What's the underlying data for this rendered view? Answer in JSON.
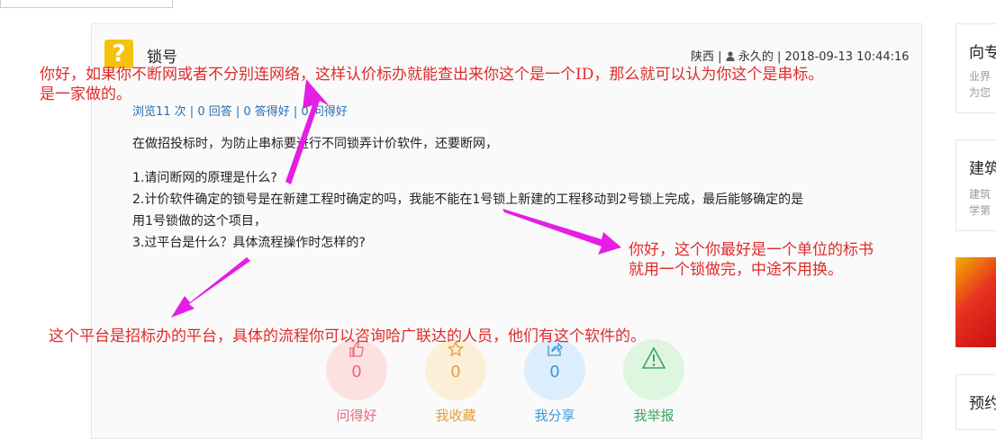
{
  "question": {
    "title": "锁号",
    "location": "陕西",
    "author": "永久的",
    "datetime": "2018-09-13 10:44:16",
    "stats": "浏览11 次 | 0 回答 | 0 答得好 | 0 问得好",
    "paragraphs": [
      "在做招投标时，为防止串标要进行不同锁弄计价软件，还要断网，",
      "1.请问断网的原理是什么?",
      "2.计价软件确定的锁号是在新建工程时确定的吗，我能不能在1号锁上新建的工程移动到2号锁上完成，最后能够确定的是",
      "用1号锁做的这个项目，",
      "3.过平台是什么？具体流程操作时怎样的?"
    ]
  },
  "actions": [
    {
      "count": "0",
      "label": "问得好",
      "icon": "thumbs-up-icon"
    },
    {
      "count": "0",
      "label": "我收藏",
      "icon": "star-icon"
    },
    {
      "count": "0",
      "label": "我分享",
      "icon": "share-icon"
    },
    {
      "count": "0",
      "label": "我举报",
      "icon": "warning-icon"
    }
  ],
  "sidebar": {
    "box1_title": "向专",
    "box1_line1": "业界",
    "box1_line2": "为您",
    "box2_title": "建筑",
    "box2_line1": "建筑",
    "box2_line2": "学第",
    "box3_title": "预约"
  },
  "annotations": {
    "a1_line1": "你好，如果你不断网或者不分别连网络，这样认价标办就能查出来你这个是一个ID，那么就可以认为你这个是串标。",
    "a1_line2": "是一家做的。",
    "a2_line1": "你好，这个你最好是一个单位的标书",
    "a2_line2": "就用一个锁做完，中途不用换。",
    "a3": "这个平台是招标办的平台，具体的流程你可以咨询哈广联达的人员，他们有这个软件的。"
  },
  "colors": {
    "annotation": "#e02a2a",
    "arrow": "#e41ee4",
    "link": "#2a6fb0",
    "question_icon": "#f5c20a"
  }
}
